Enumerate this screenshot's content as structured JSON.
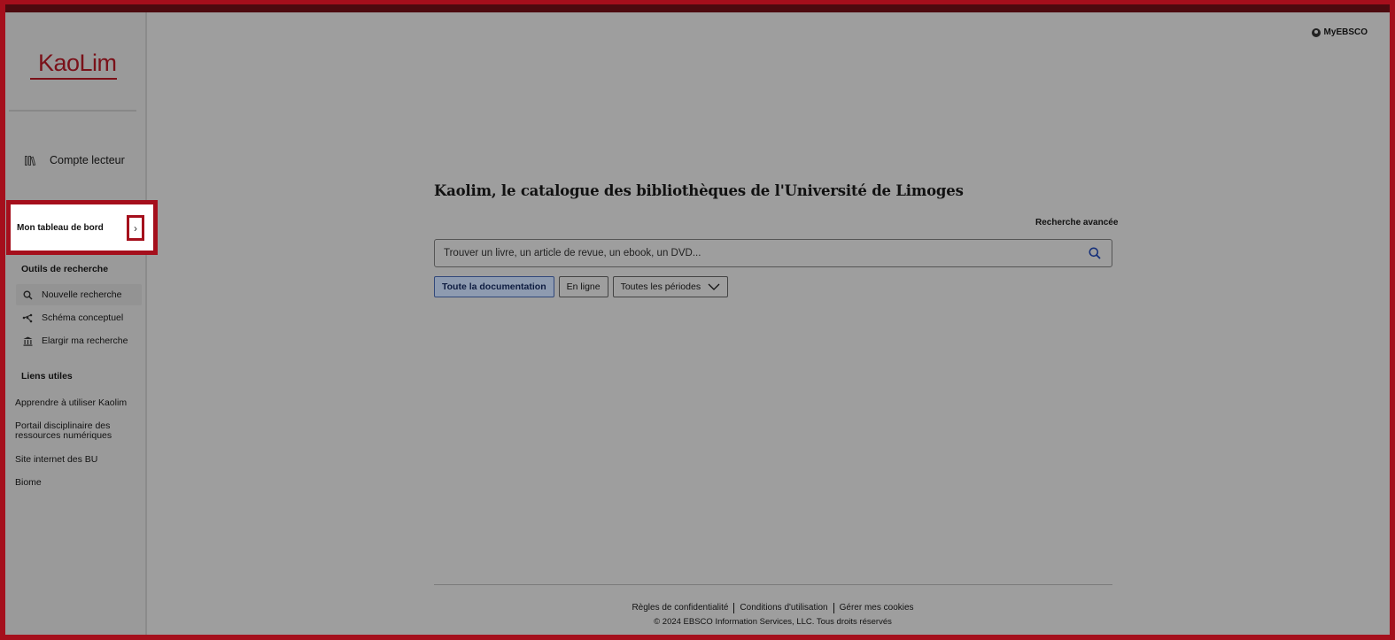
{
  "sidebar": {
    "logo_text": "KaoLim",
    "account_label": "Compte lecteur",
    "dashboard_label": "Mon tableau de bord",
    "search_tools_title": "Outils de recherche",
    "search_tools": [
      {
        "label": "Nouvelle recherche",
        "icon": "search-icon"
      },
      {
        "label": "Schéma conceptuel",
        "icon": "concept-map-icon"
      },
      {
        "label": "Elargir ma recherche",
        "icon": "library-icon"
      }
    ],
    "useful_links_title": "Liens utiles",
    "useful_links": [
      "Apprendre à utiliser Kaolim",
      "Portail disciplinaire des ressources numériques",
      "Site internet des BU",
      "Biome"
    ]
  },
  "header": {
    "myebsco_label": "MyEBSCO"
  },
  "main": {
    "title": "Kaolim, le catalogue des bibliothèques de l'Université de Limoges",
    "advanced_search_label": "Recherche avancée",
    "search_placeholder": "Trouver un livre, un article de revue, un ebook, un DVD...",
    "filters": {
      "all": "Toute la documentation",
      "online": "En ligne",
      "periods": "Toutes les périodes"
    }
  },
  "footer": {
    "privacy": "Règles de confidentialité",
    "terms": "Conditions d'utilisation",
    "cookies": "Gérer mes cookies",
    "copyright": "© 2024 EBSCO Information Services, LLC. Tous droits réservés"
  },
  "colors": {
    "highlight": "#a50f1c",
    "overlay": "#9e9e9e",
    "selected_chip": "#32487a"
  }
}
